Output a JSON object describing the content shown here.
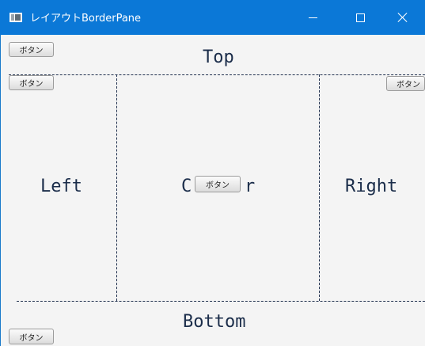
{
  "window": {
    "title": "レイアウトBorderPane",
    "icon": "app-window-icon",
    "titlebar_color": "#0b78d7"
  },
  "regions": {
    "top_label": "Top",
    "left_label": "Left",
    "center_label_start": "C",
    "center_label_end": "r",
    "right_label": "Right",
    "bottom_label": "Bottom"
  },
  "buttons": {
    "top": "ボタン",
    "left": "ボタン",
    "center": "ボタン",
    "right": "ボタン",
    "bottom": "ボタン"
  },
  "colors": {
    "label_text": "#1b2d4a",
    "border_line": "#1f2f4d",
    "background": "#f4f4f4"
  }
}
